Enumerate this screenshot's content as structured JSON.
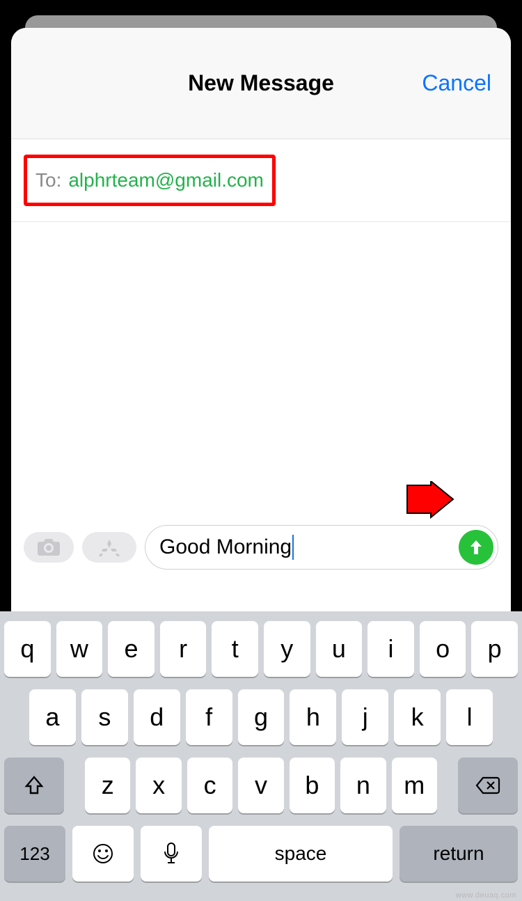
{
  "header": {
    "title": "New Message",
    "cancel": "Cancel"
  },
  "to": {
    "label": "To:",
    "value": "alphrteam@gmail.com"
  },
  "compose": {
    "text": "Good Morning"
  },
  "keyboard": {
    "row1": [
      "q",
      "w",
      "e",
      "r",
      "t",
      "y",
      "u",
      "i",
      "o",
      "p"
    ],
    "row2": [
      "a",
      "s",
      "d",
      "f",
      "g",
      "h",
      "j",
      "k",
      "l"
    ],
    "row3": [
      "z",
      "x",
      "c",
      "v",
      "b",
      "n",
      "m"
    ],
    "numeric": "123",
    "space": "space",
    "return": "return"
  },
  "watermark": "www.deuaq.com"
}
